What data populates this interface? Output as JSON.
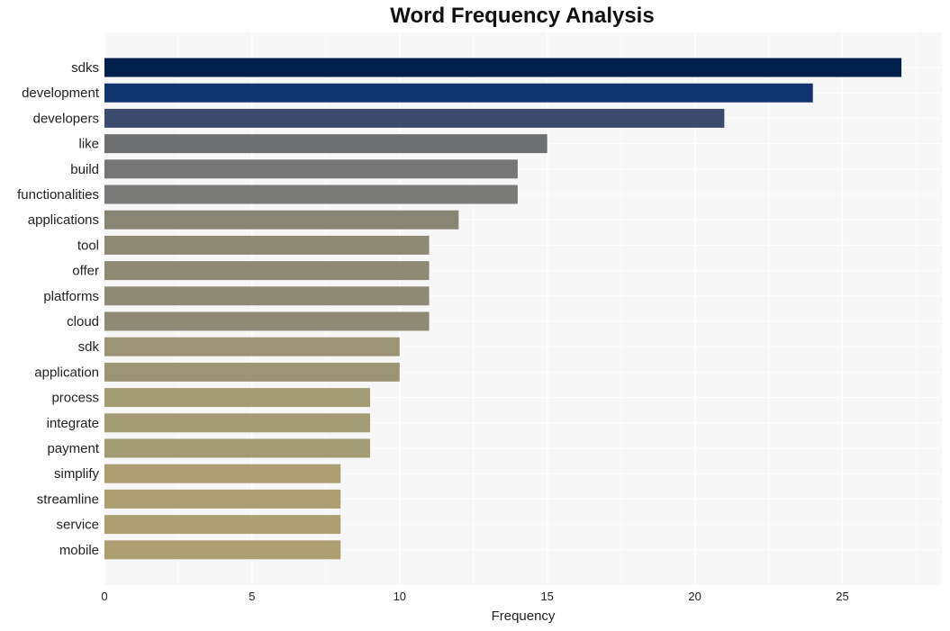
{
  "chart_data": {
    "type": "bar",
    "orientation": "horizontal",
    "title": "Word Frequency Analysis",
    "xlabel": "Frequency",
    "ylabel": "",
    "xlim": [
      0,
      28.4
    ],
    "xticks": [
      0,
      5,
      10,
      15,
      20,
      25
    ],
    "grid": true,
    "categories": [
      "sdks",
      "development",
      "developers",
      "like",
      "build",
      "functionalities",
      "applications",
      "tool",
      "offer",
      "platforms",
      "cloud",
      "sdk",
      "application",
      "process",
      "integrate",
      "payment",
      "simplify",
      "streamline",
      "service",
      "mobile"
    ],
    "values": [
      27,
      24,
      21,
      15,
      14,
      14,
      12,
      11,
      11,
      11,
      11,
      10,
      10,
      9,
      9,
      9,
      8,
      8,
      8,
      8
    ],
    "colors": [
      "#00204c",
      "#12346e",
      "#3c4a6e",
      "#6f7072",
      "#767676",
      "#7a7a78",
      "#888574",
      "#8f8a76",
      "#8f8a76",
      "#8f8a76",
      "#8f8a76",
      "#9c9575",
      "#9c9575",
      "#a39b74",
      "#a39b74",
      "#a39b74",
      "#ad9f72",
      "#ad9f72",
      "#ad9f72",
      "#ad9f72"
    ]
  }
}
